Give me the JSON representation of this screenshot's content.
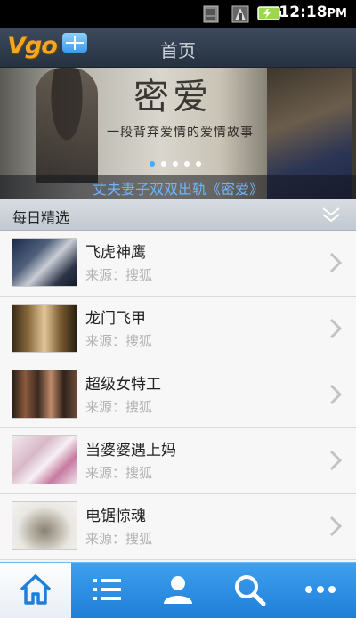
{
  "status_bar": {
    "time": "12:18",
    "time_suffix": "PM",
    "icons": [
      "image-icon",
      "signal-icon",
      "battery-icon"
    ]
  },
  "header": {
    "logo_text": "Vgo",
    "title": "首页"
  },
  "banner": {
    "image_title": "密爱",
    "image_subtitle": "一段背弃爱情的爱情故事",
    "caption": "丈夫妻子双双出轨《密爱》",
    "total_pages": 5,
    "active_page": 1
  },
  "section": {
    "title": "每日精选"
  },
  "list": {
    "items": [
      {
        "title": "飞虎神鹰",
        "source": "来源：搜狐"
      },
      {
        "title": "龙门飞甲",
        "source": "来源：搜狐"
      },
      {
        "title": "超级女特工",
        "source": "来源：搜狐"
      },
      {
        "title": "当婆婆遇上妈",
        "source": "来源：搜狐"
      },
      {
        "title": "电锯惊魂",
        "source": "来源：搜狐"
      }
    ]
  },
  "tab_bar": {
    "tabs": [
      "home-icon",
      "list-icon",
      "user-icon",
      "search-icon",
      "more-icon"
    ],
    "active_index": 0
  },
  "colors": {
    "accent": "#1f7fd8",
    "caption": "#6fb6ff",
    "logo": "#f5a623"
  }
}
